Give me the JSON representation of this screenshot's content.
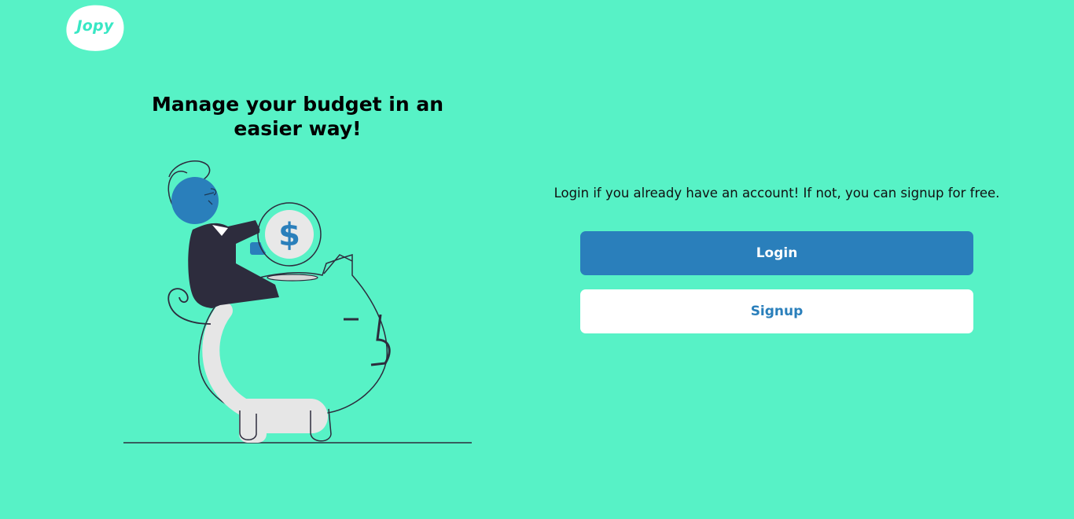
{
  "brand": {
    "name": "Jopy",
    "logo_color": "#38e7c4",
    "background_color": "#57f2c6"
  },
  "hero": {
    "headline": "Manage your budget in an easier way!",
    "illustration": "person-putting-coin-in-piggy-bank"
  },
  "auth": {
    "prompt": "Login if you already have an account! If not, you can signup for free.",
    "login_label": "Login",
    "signup_label": "Signup",
    "primary_color": "#2a7fbb"
  },
  "icons": {
    "coin": "dollar-coin-icon"
  }
}
